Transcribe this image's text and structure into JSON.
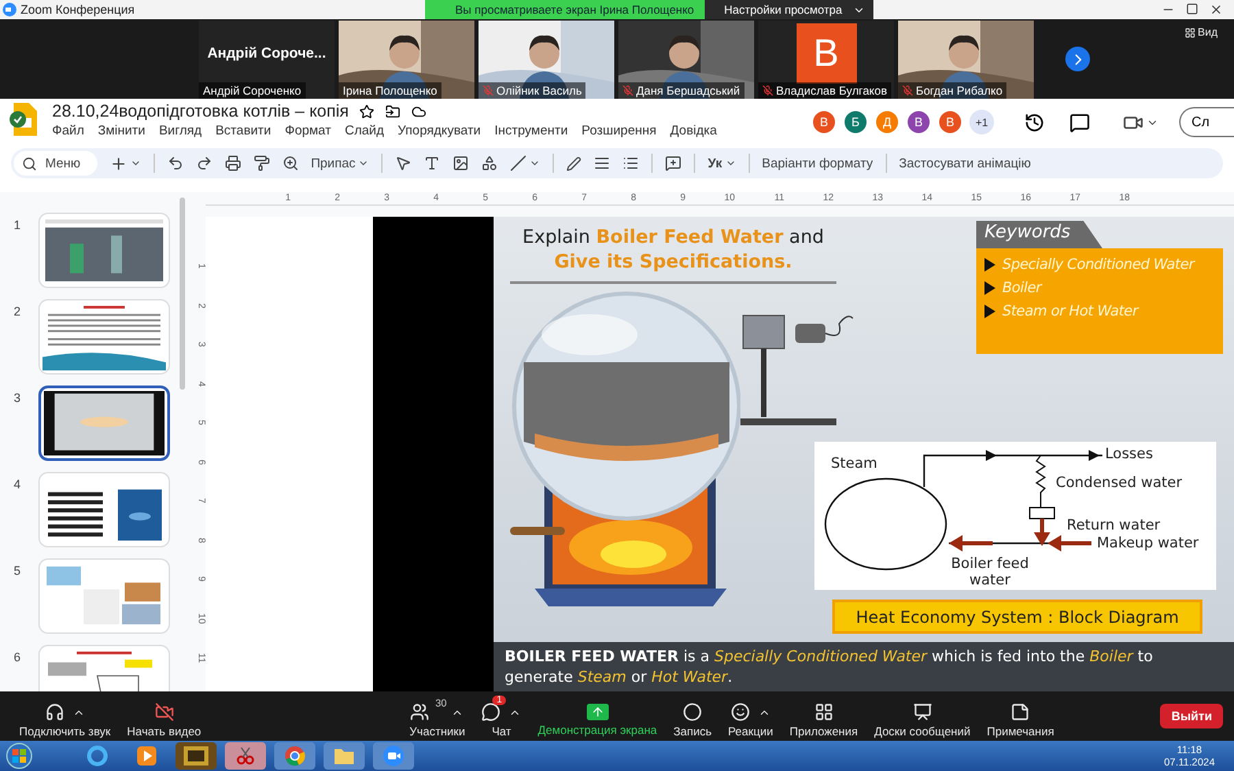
{
  "zoom_titlebar": {
    "title": "Zoom Конференция",
    "share_banner": "Вы просматриваете экран Ірина Полощенко",
    "view_settings": "Настройки просмотра"
  },
  "participants": [
    {
      "kind": "name",
      "display": "Андрій Сороче...",
      "name": "Андрій Сороченко",
      "muted": false
    },
    {
      "kind": "video",
      "name": "Ірина Полощенко",
      "muted": false
    },
    {
      "kind": "video",
      "name": "Олійник Василь",
      "muted": true
    },
    {
      "kind": "video",
      "name": "Даня Бершадський",
      "muted": true
    },
    {
      "kind": "avatar",
      "initial": "B",
      "name": "Владислав Булгаков",
      "muted": true
    },
    {
      "kind": "video",
      "name": "Богдан Рибалко",
      "muted": true
    }
  ],
  "view_button": "Вид",
  "document": {
    "title": "28.10,24водопідготовка котлів  – копія",
    "menu": [
      "Файл",
      "Змінити",
      "Вигляд",
      "Вставити",
      "Формат",
      "Слайд",
      "Упорядкувати",
      "Інструменти",
      "Розширення",
      "Довідка"
    ],
    "collaborators": [
      {
        "initial": "В",
        "color": "#e8501e"
      },
      {
        "initial": "Б",
        "color": "#0f7b6c"
      },
      {
        "initial": "Д",
        "color": "#f57c00"
      },
      {
        "initial": "В",
        "color": "#8e44ad"
      },
      {
        "initial": "В",
        "color": "#e8501e"
      }
    ],
    "more_collaborators": "+1",
    "share_button": "Сл"
  },
  "toolbar": {
    "menu_search": "Меню",
    "zoom": "Припас",
    "input_tools": "Ук",
    "format_options": "Варіанти формату",
    "animate": "Застосувати анімацію"
  },
  "slides": [
    {
      "number": "1",
      "selected": false
    },
    {
      "number": "2",
      "selected": false
    },
    {
      "number": "3",
      "selected": true
    },
    {
      "number": "4",
      "selected": false
    },
    {
      "number": "5",
      "selected": false
    },
    {
      "number": "6",
      "selected": false
    }
  ],
  "ruler": {
    "horizontal": [
      "1",
      "2",
      "3",
      "4",
      "5",
      "6",
      "7",
      "8",
      "9",
      "10",
      "11",
      "12",
      "13",
      "14",
      "15",
      "16",
      "17",
      "18"
    ],
    "vertical": [
      "1",
      "2",
      "3",
      "4",
      "5",
      "6",
      "7",
      "8",
      "9",
      "10",
      "11"
    ]
  },
  "slide": {
    "heading": [
      "Explain **Boiler Feed Water** and",
      "Give its Specifications."
    ],
    "keywords_title": "Keywords",
    "keywords": [
      "Specially Conditioned Water",
      "Boiler",
      "Steam or Hot Water"
    ],
    "diagram": {
      "steam": "Steam",
      "losses": "Losses",
      "condensed": "Condensed water",
      "return": "Return water",
      "makeup": "Makeup water",
      "feed": "Boiler feed water"
    },
    "caption": "Heat Economy System : Block Diagram",
    "footer": "**BOILER FEED WATER** is a *Specially Conditioned Water* which is fed into the *Boiler* to generate *Steam* or *Hot Water*."
  },
  "controls": [
    {
      "kind": "audio",
      "label": "Подключить звук",
      "menu": true
    },
    {
      "kind": "video",
      "label": "Начать видео",
      "menu": false
    },
    {
      "kind": "participants",
      "label": "Участники",
      "count": "30",
      "menu": true
    },
    {
      "kind": "chat",
      "label": "Чат",
      "badge": "1",
      "menu": true
    },
    {
      "kind": "share",
      "label": "Демонстрация экрана",
      "menu": false
    },
    {
      "kind": "record",
      "label": "Запись",
      "menu": false
    },
    {
      "kind": "reactions",
      "label": "Реакции",
      "menu": true
    },
    {
      "kind": "apps",
      "label": "Приложения",
      "menu": false
    },
    {
      "kind": "whiteboards",
      "label": "Доски сообщений",
      "menu": false
    },
    {
      "kind": "notes",
      "label": "Примечания",
      "menu": false
    }
  ],
  "leave_button": "Выйти",
  "taskbar": {
    "time": "11:18",
    "date": "07.11.2024"
  }
}
